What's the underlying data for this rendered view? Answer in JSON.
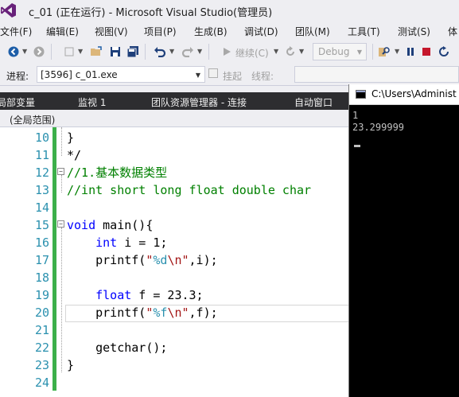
{
  "window": {
    "title": "c_01 (正在运行) - Microsoft Visual Studio(管理员)"
  },
  "menu": {
    "items": [
      {
        "label": "文件(F)"
      },
      {
        "label": "编辑(E)"
      },
      {
        "label": "视图(V)"
      },
      {
        "label": "项目(P)"
      },
      {
        "label": "生成(B)"
      },
      {
        "label": "调试(D)"
      },
      {
        "label": "团队(M)"
      },
      {
        "label": "工具(T)"
      },
      {
        "label": "测试(S)"
      },
      {
        "label": "体"
      }
    ]
  },
  "toolbar": {
    "continue_label": "继续(C)",
    "configuration": "Debug",
    "icons": [
      "back-icon",
      "forward-icon",
      "new-project-icon",
      "open-icon",
      "save-icon",
      "save-all-icon",
      "undo-icon",
      "redo-icon",
      "continue-icon",
      "refresh-icon",
      "find-icon",
      "pause-icon",
      "stop-icon",
      "restart-icon"
    ]
  },
  "debug_location": {
    "process_label": "进程:",
    "process_value": "[3596] c_01.exe",
    "suspend_label": "挂起",
    "thread_label": "线程:"
  },
  "tool_tabs": [
    {
      "label": "局部变量"
    },
    {
      "label": "监视 1"
    },
    {
      "label": "团队资源管理器 - 连接"
    },
    {
      "label": "自动窗口"
    }
  ],
  "editor": {
    "scope": "(全局范围)",
    "lines": [
      {
        "num": "10",
        "text": "}"
      },
      {
        "num": "11",
        "text": "*/"
      },
      {
        "num": "12",
        "text": "//1.基本数据类型"
      },
      {
        "num": "13",
        "text": "//int short long float double char"
      },
      {
        "num": "14",
        "text": ""
      },
      {
        "num": "15",
        "text": "void main(){"
      },
      {
        "num": "16",
        "text": "    int i = 1;"
      },
      {
        "num": "17",
        "text": "    printf(\"%d\\n\",i);"
      },
      {
        "num": "18",
        "text": ""
      },
      {
        "num": "19",
        "text": "    float f = 23.3;"
      },
      {
        "num": "20",
        "text": "    printf(\"%f\\n\",f);"
      },
      {
        "num": "21",
        "text": ""
      },
      {
        "num": "22",
        "text": "    getchar();"
      },
      {
        "num": "23",
        "text": "}"
      },
      {
        "num": "24",
        "text": ""
      }
    ]
  },
  "console": {
    "title": "C:\\Users\\Administ",
    "output": "1\n23.299999"
  },
  "colors": {
    "keyword": "#0000ff",
    "comment": "#008000",
    "string": "#a31515",
    "line_number": "#2b91af",
    "change_bar": "#3cb04a",
    "vs_purple": "#68217a"
  }
}
